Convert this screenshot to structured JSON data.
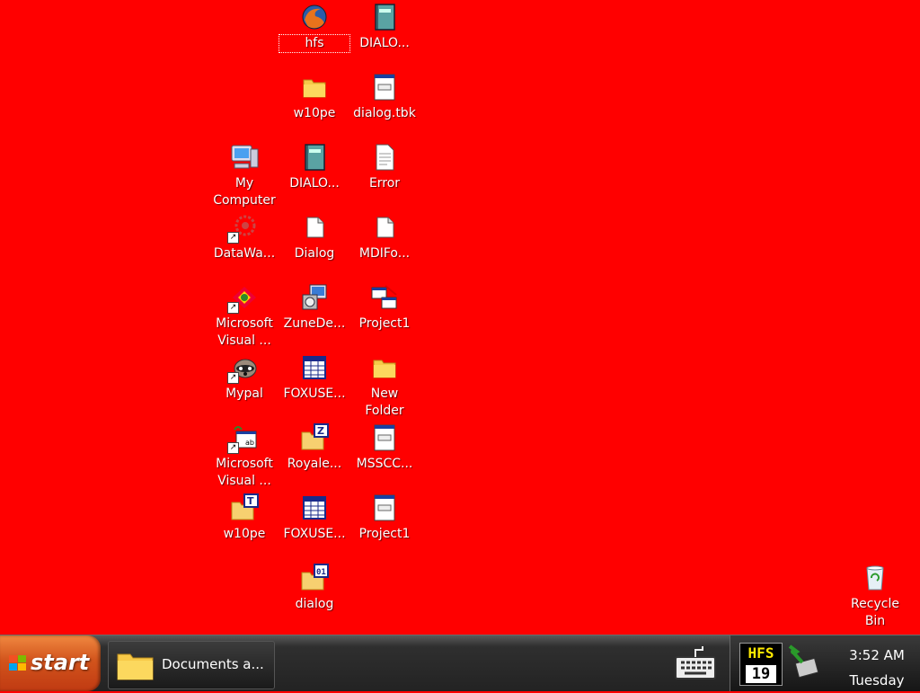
{
  "desktop": {
    "background": "#ff0000",
    "icons": {
      "hfs": "hfs",
      "dialo_1": "DIALO...",
      "w10pe_folder": "w10pe",
      "dialog_tbk": "dialog.tbk",
      "my_computer": "My Computer",
      "dialo_2": "DIALO...",
      "error": "Error",
      "datawa": "DataWa...",
      "dialog_doc": "Dialog",
      "mdifo": "MDIFo...",
      "ms_visual_1": "Microsoft Visual ...",
      "zunede": "ZuneDe...",
      "project1_a": "Project1",
      "mypal": "Mypal",
      "foxuse_1": "FOXUSE...",
      "new_folder": "New Folder",
      "ms_visual_2": "Microsoft Visual ...",
      "royale": "Royale...",
      "msscc": "MSSCC...",
      "w10pe_t": "w10pe",
      "foxuse_2": "FOXUSE...",
      "project1_b": "Project1",
      "dialog_folder": "dialog",
      "recycle_bin": "Recycle Bin"
    }
  },
  "taskbar": {
    "start_label": "start",
    "task_button_label": "Documents a...",
    "tray": {
      "hfs_top": "HFS",
      "hfs_day": "19",
      "time": "3:52 AM",
      "day": "Tuesday"
    }
  }
}
